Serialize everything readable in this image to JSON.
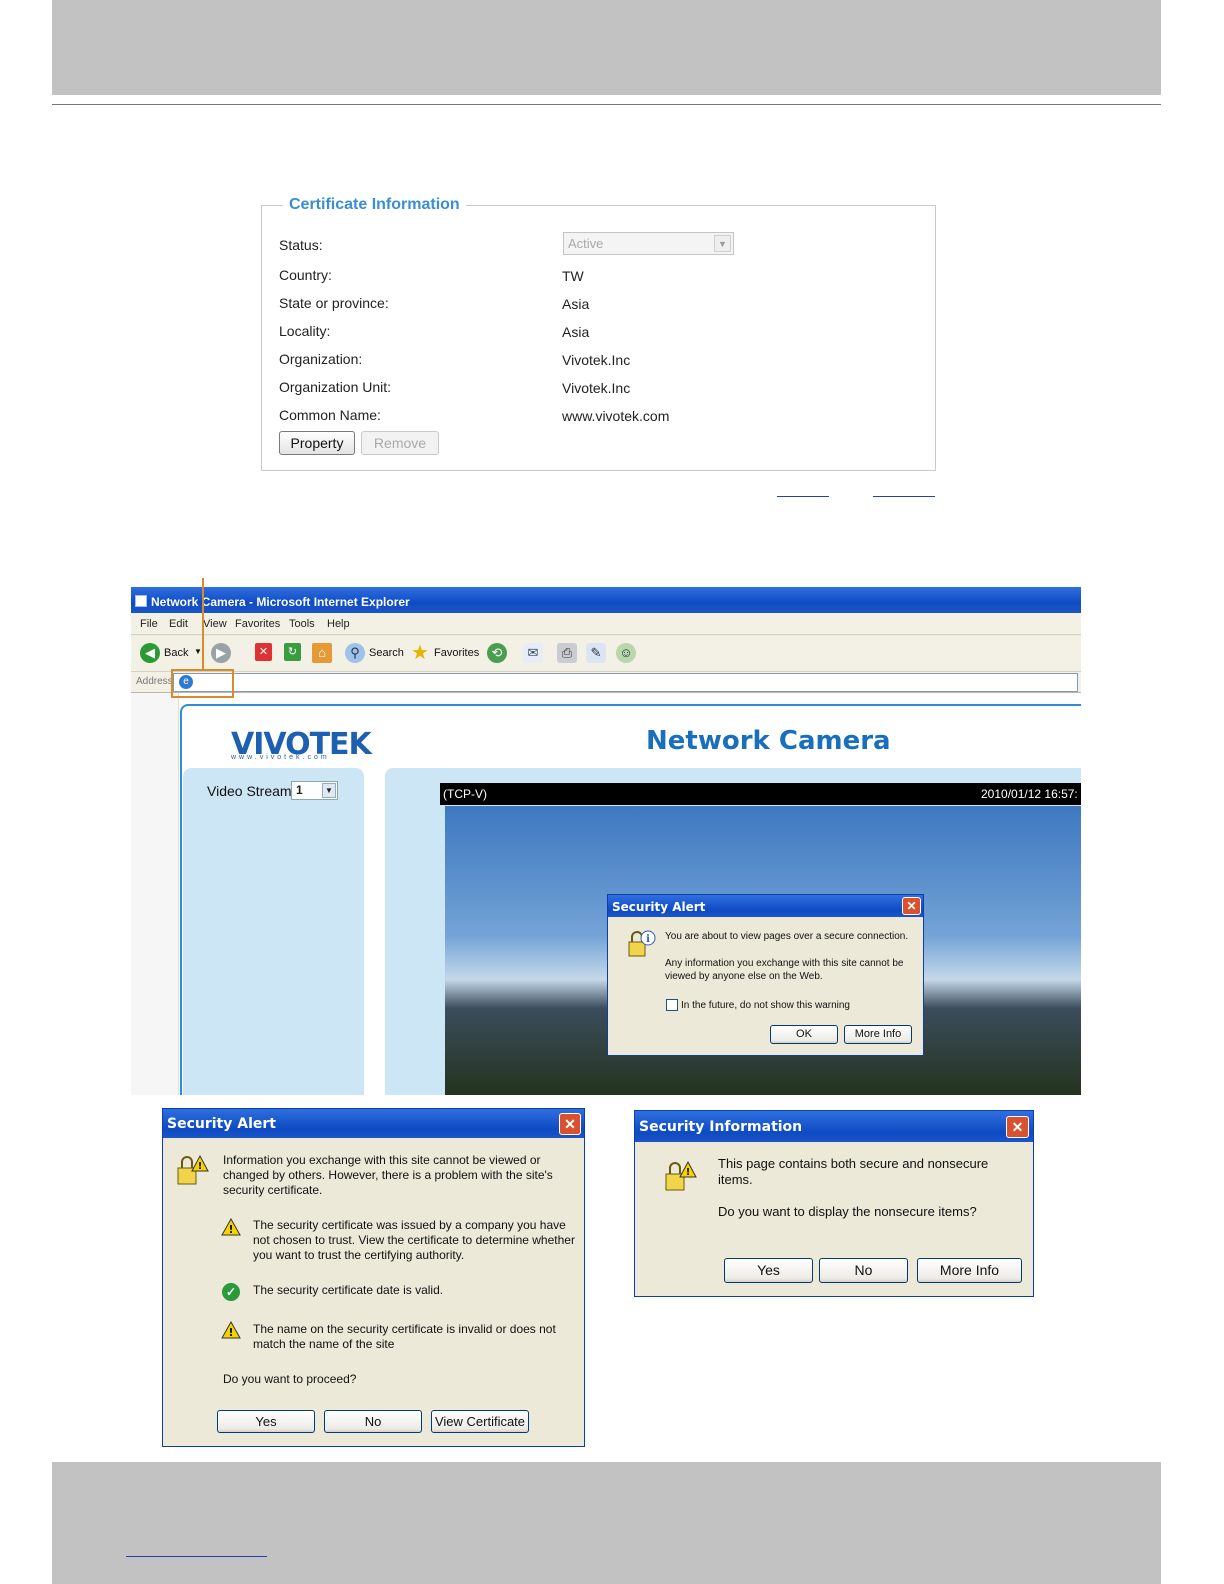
{
  "certificate": {
    "legend": "Certificate Information",
    "status_label": "Status:",
    "status_value": "Active",
    "fields": [
      {
        "label": "Country:",
        "value": "TW"
      },
      {
        "label": "State or province:",
        "value": "Asia"
      },
      {
        "label": "Locality:",
        "value": "Asia"
      },
      {
        "label": "Organization:",
        "value": "Vivotek.Inc"
      },
      {
        "label": "Organization Unit:",
        "value": "Vivotek.Inc"
      },
      {
        "label": "Common Name:",
        "value": "www.vivotek.com"
      }
    ],
    "property_button": "Property",
    "remove_button": "Remove"
  },
  "browser": {
    "title": "Network Camera - Microsoft Internet Explorer",
    "menu": [
      "File",
      "Edit",
      "View",
      "Favorites",
      "Tools",
      "Help"
    ],
    "toolbar": {
      "back": "Back",
      "search": "Search",
      "favorites": "Favorites"
    },
    "address_label": "Address"
  },
  "camera_page": {
    "logo": "VIVOTEK",
    "logo_sub": "www.vivotek.com",
    "title": "Network Camera",
    "video_stream_label": "Video Stream",
    "video_stream_value": "1",
    "video_protocol": "(TCP-V)",
    "video_timestamp": "2010/01/12 16:57:"
  },
  "alert_small": {
    "title": "Security Alert",
    "line1": "You are about to view pages over a secure connection.",
    "line2": "Any information you exchange with this site cannot be viewed by anyone else on the Web.",
    "checkbox_label": "In the future, do not show this warning",
    "ok_button": "OK",
    "more_info_button": "More Info"
  },
  "alert_large": {
    "title": "Security Alert",
    "intro": "Information you exchange with this site cannot be viewed or changed by others. However, there is a problem with the site's security certificate.",
    "item1": "The security certificate was issued by a company you have not chosen to trust. View the certificate to determine whether you want to trust the certifying authority.",
    "item2": "The security certificate date is valid.",
    "item3": "The name on the security certificate is invalid or does not match the name of the site",
    "question": "Do you want to proceed?",
    "yes_button": "Yes",
    "no_button": "No",
    "view_certificate_button": "View Certificate"
  },
  "security_info": {
    "title": "Security Information",
    "line1": "This page contains both secure and nonsecure items.",
    "question": "Do you want to display the nonsecure items?",
    "yes_button": "Yes",
    "no_button": "No",
    "more_info_button": "More Info"
  },
  "colors": {
    "legend_blue": "#3a8fd0",
    "xp_title_blue": "#0e4ac2",
    "highlight_orange": "#d98a2b",
    "page_band_gray": "#c2c2c2"
  }
}
